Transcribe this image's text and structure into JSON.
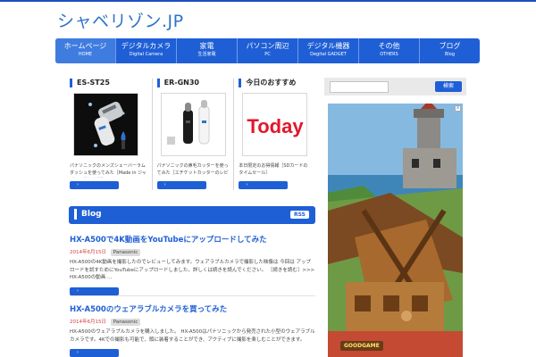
{
  "site": {
    "logo": "シャベリゾン.JP"
  },
  "nav": [
    {
      "label": "ホームページ",
      "sub": "HOME"
    },
    {
      "label": "デジタルカメラ",
      "sub": "Digital Camera"
    },
    {
      "label": "家電",
      "sub": "生活家電"
    },
    {
      "label": "パソコン周辺",
      "sub": "PC"
    },
    {
      "label": "デジタル機器",
      "sub": "Degital GADGET"
    },
    {
      "label": "その他",
      "sub": "OTHERS"
    },
    {
      "label": "ブログ",
      "sub": "Blog"
    }
  ],
  "pickups": [
    {
      "title": "ES-ST25",
      "text": "パナソニックのメンズシェーバーラムダッシュを使ってみた［Made in ジャパンの剃り心地］",
      "button": "›"
    },
    {
      "title": "ER-GN30",
      "text": "パナソニックの鼻毛カッターを使ってみた［エチケットカッターのレビュー］",
      "button": "›"
    },
    {
      "title": "今日のおすすめ",
      "text": "本日限定のお得情報［SDカードのタイムセール］",
      "button": "›"
    }
  ],
  "search": {
    "placeholder": "",
    "button": "検索"
  },
  "blog": {
    "title": "Blog",
    "rss": "RSS",
    "posts": [
      {
        "title": "HX-A500で4K動画をYouTubeにアップロードしてみた",
        "date": "2014年6月15日",
        "tag": "Panasonic",
        "body": "HX-A500の4K動画を撮影したのでレビューしてみます。ウェアラブルカメラで撮影した映像は 今回は アップロードを試すためにYouTubeにアップロードしました。詳しくは続きを読んでください。 ［続きを読む］>>> HX-A500の動画 ...",
        "button": "›"
      },
      {
        "title": "HX-A500のウェアラブルカメラを買ってみた",
        "date": "2014年6月15日",
        "tag": "Panasonic",
        "body": "HX-A500のウェアラブルカメラを購入しました。 HX-A500はパナソニックから発売された小型のウェアラブルカメラです。4Kでの撮影も可能で、頭に装着することができ、アクティブに撮影を楽しむことができます。",
        "button": "›"
      }
    ]
  },
  "ad": {
    "close": "x",
    "brand": "GOODGAME"
  },
  "colors": {
    "accent": "#1f5fd6",
    "date": "#d24040"
  }
}
